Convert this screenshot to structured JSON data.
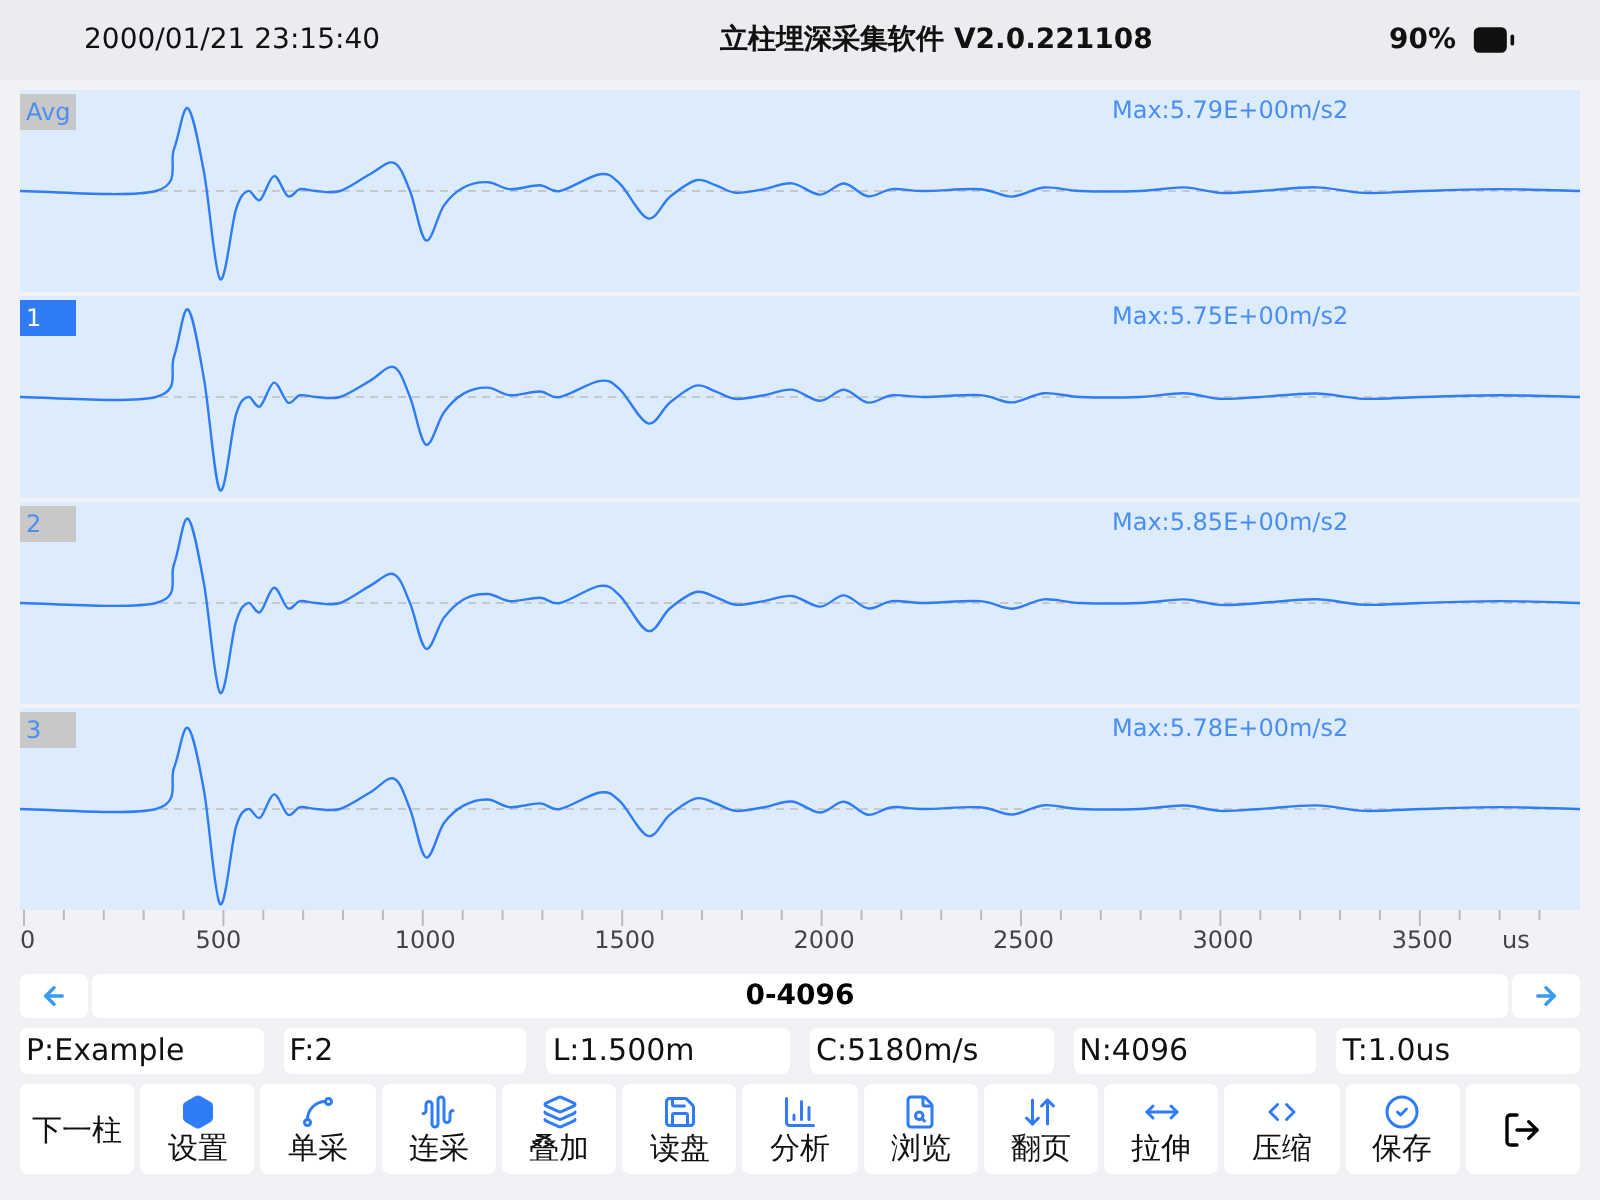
{
  "status_bar": {
    "datetime": "2000/01/21 23:15:40",
    "title": "立柱埋深采集软件 V2.0.221108",
    "battery": "90%"
  },
  "channels": [
    {
      "label": "Avg",
      "selected": false,
      "max": "Max:5.79E+00m/s2"
    },
    {
      "label": "1",
      "selected": true,
      "max": "Max:5.75E+00m/s2"
    },
    {
      "label": "2",
      "selected": false,
      "max": "Max:5.85E+00m/s2"
    },
    {
      "label": "3",
      "selected": false,
      "max": "Max:5.78E+00m/s2"
    }
  ],
  "axis": {
    "ticks": [
      "0",
      "500",
      "1000",
      "1500",
      "2000",
      "2500",
      "3000",
      "3500"
    ],
    "unit": "us"
  },
  "range": {
    "label": "0-4096"
  },
  "info": [
    "P:Example",
    "F:2",
    "L:1.500m",
    "C:5180m/s",
    "N:4096",
    "T:1.0us"
  ],
  "toolbar": [
    {
      "kind": "text",
      "label": "下一柱"
    },
    {
      "kind": "labeled",
      "label": "设置"
    },
    {
      "kind": "labeled",
      "label": "单采"
    },
    {
      "kind": "labeled",
      "label": "连采"
    },
    {
      "kind": "labeled",
      "label": "叠加"
    },
    {
      "kind": "labeled",
      "label": "读盘"
    },
    {
      "kind": "labeled",
      "label": "分析"
    },
    {
      "kind": "labeled",
      "label": "浏览"
    },
    {
      "kind": "labeled",
      "label": "翻页"
    },
    {
      "kind": "labeled",
      "label": "拉伸"
    },
    {
      "kind": "labeled",
      "label": "压缩"
    },
    {
      "kind": "labeled",
      "label": "保存"
    },
    {
      "kind": "icon"
    }
  ]
}
